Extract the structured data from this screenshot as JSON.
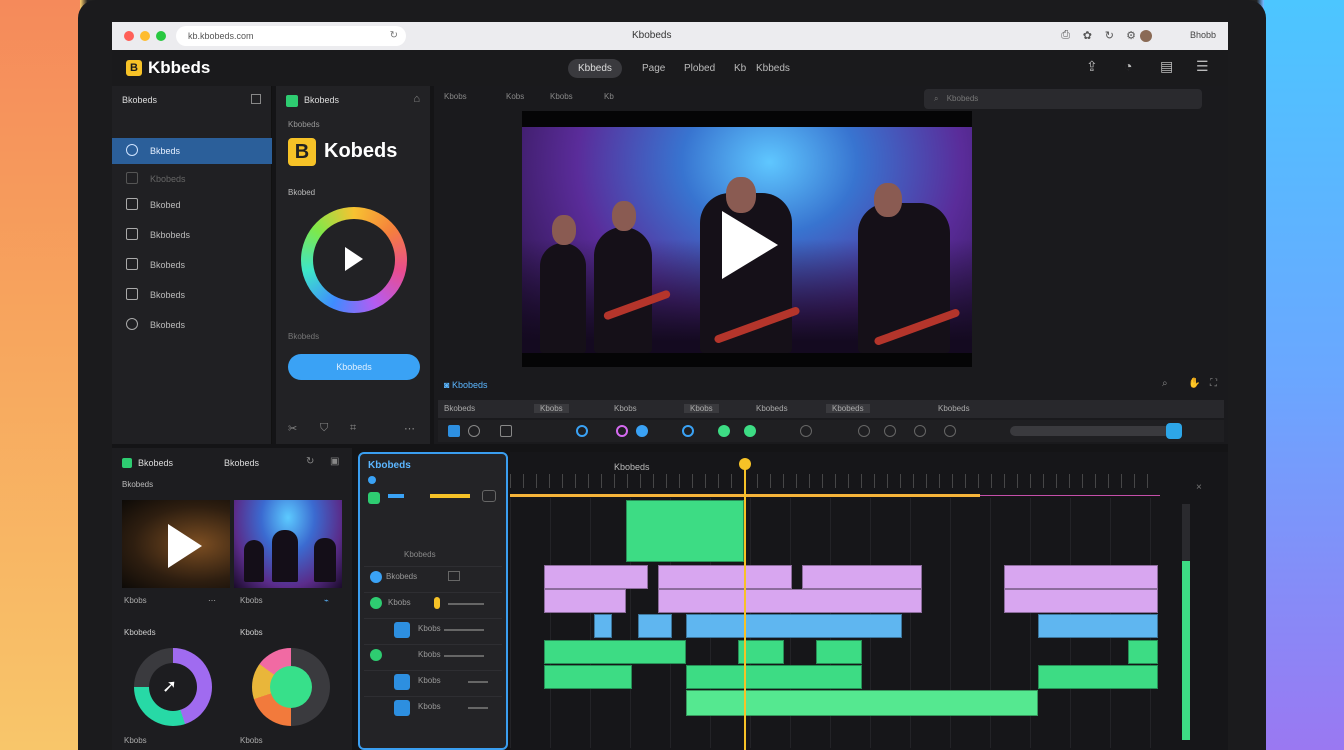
{
  "browser": {
    "url": "kb.kbobeds.com",
    "title": "Kbobeds",
    "user": "Bhobb"
  },
  "app": {
    "logo_letter": "B",
    "name": "Kbbeds",
    "nav": [
      "Kbbeds",
      "Page",
      "Plobed",
      "Kb",
      "Kbbeds"
    ],
    "header_icons": [
      "upload-icon",
      "clock-icon",
      "document-icon",
      "menu-icon"
    ]
  },
  "sidebar": {
    "title": "Bkobeds",
    "items": [
      {
        "label": "Bkbeds",
        "icon": "compass-icon"
      },
      {
        "label": "Kbobeds",
        "icon": "folder-icon"
      },
      {
        "label": "Bkobed",
        "icon": "list-icon"
      },
      {
        "label": "Bkbobeds",
        "icon": "document-icon"
      },
      {
        "label": "Bkobeds",
        "icon": "image-icon"
      },
      {
        "label": "Bkobeds",
        "icon": "grid-icon"
      },
      {
        "label": "Bkobeds",
        "icon": "circle-icon"
      }
    ]
  },
  "preset": {
    "title": "Bkobeds",
    "subtitle": "Kbobeds",
    "logo_letter": "B",
    "logo_text": "Kobeds",
    "section": "Bkobed",
    "caption": "Bkobeds",
    "button": "Kbobeds"
  },
  "preview": {
    "tabs": [
      "Kbobs",
      "Kobs",
      "Kbobs",
      "Kb"
    ],
    "search_placeholder": "Kbobeds",
    "label": "Kbobeds",
    "toolbar": [
      "Bkobeds",
      "Kbobs",
      "Kbobs",
      "Kbobs",
      "Kbobeds",
      "Kbobeds",
      "Kbobeds"
    ]
  },
  "media": {
    "title_a": "Bkobeds",
    "title_b": "Bkobeds",
    "subtitle": "Bkobeds",
    "thumb_labels": [
      "Kbobs",
      "Kbobs"
    ],
    "section_labels": [
      "Kbobeds",
      "Kbobs"
    ],
    "donut_labels": [
      "Kbobs",
      "Kbobs"
    ]
  },
  "tracks": {
    "title": "Kbobeds",
    "subtitle": "Kbobeds",
    "rows": [
      "Bkobeds",
      "Kbobs",
      "Kbobs",
      "Kbobs",
      "Kbobs",
      "Kbobs"
    ]
  },
  "timeline": {
    "title": "Kbobeds"
  },
  "colors": {
    "accent": "#3aa2f5",
    "logo": "#f6c227",
    "green": "#3ddc84",
    "pink": "#d8a6f0",
    "blue": "#5fb6f0"
  }
}
